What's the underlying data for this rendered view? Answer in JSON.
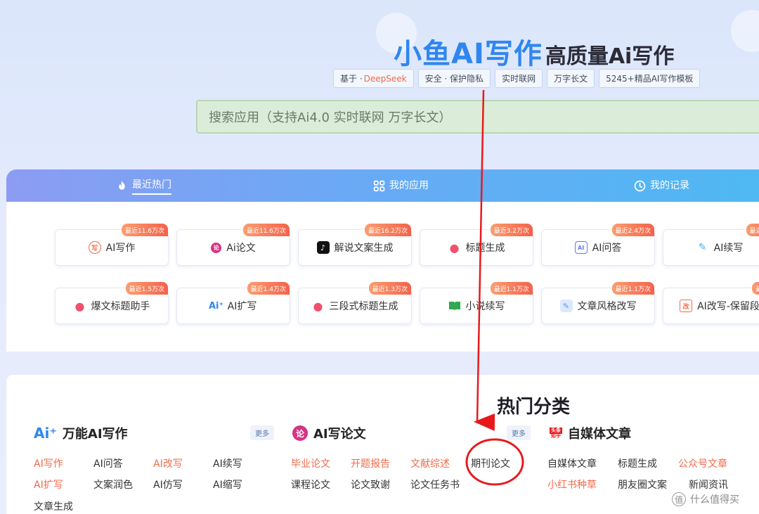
{
  "header": {
    "brand_main": "小鱼AI写作",
    "brand_sub": "高质量Ai写作",
    "tags": [
      {
        "text": "基于 · ",
        "highlight": "DeepSeek"
      },
      {
        "text": "安全 · 保护隐私",
        "highlight": ""
      },
      {
        "text": "实时联网",
        "highlight": ""
      },
      {
        "text": "万字长文",
        "highlight": ""
      },
      {
        "text": "5245+精品AI写作模板",
        "highlight": ""
      }
    ]
  },
  "search": {
    "placeholder": "搜索应用（支持Ai4.0 实时联网 万字长文）"
  },
  "tabs": [
    {
      "label": "最近热门",
      "icon": "fire-icon",
      "active": true
    },
    {
      "label": "我的应用",
      "icon": "grid-icon",
      "active": false
    },
    {
      "label": "我的记录",
      "icon": "clock-icon",
      "active": false
    }
  ],
  "apps_row1": [
    {
      "label": "AI写作",
      "badge": "最近11.6万次",
      "icon": "write-icon",
      "color": "#f26a4a"
    },
    {
      "label": "Ai论文",
      "badge": "最近11.6万次",
      "icon": "paper-icon",
      "color": "#d63384"
    },
    {
      "label": "解说文案生成",
      "badge": "最近16.2万次",
      "icon": "tiktok-icon",
      "color": "#111111"
    },
    {
      "label": "标题生成",
      "badge": "最近3.2万次",
      "icon": "tag-icon",
      "color": "#f0506e"
    },
    {
      "label": "AI问答",
      "badge": "最近2.4万次",
      "icon": "chat-icon",
      "color": "#5b7cf0"
    },
    {
      "label": "AI续写",
      "badge": "最近2.2",
      "icon": "pen-icon",
      "color": "#4db0e8"
    }
  ],
  "apps_row2": [
    {
      "label": "爆文标题助手",
      "badge": "最近1.5万次",
      "icon": "tag-icon",
      "color": "#f0506e"
    },
    {
      "label": "AI扩写",
      "badge": "最近1.4万次",
      "icon": "ai-expand-icon",
      "color": "#2f86f0"
    },
    {
      "label": "三段式标题生成",
      "badge": "最近1.3万次",
      "icon": "tag-icon",
      "color": "#f0506e"
    },
    {
      "label": "小说续写",
      "badge": "最近1.1万次",
      "icon": "book-icon",
      "color": "#2fa84f"
    },
    {
      "label": "文章风格改写",
      "badge": "最近1.1万次",
      "icon": "edit-icon",
      "color": "#5b9cf0"
    },
    {
      "label": "AI改写-保留段",
      "badge": "最近1",
      "icon": "rewrite-icon",
      "color": "#f26a4a"
    }
  ],
  "hot": {
    "title": "热门分类",
    "more_label": "更多",
    "categories": [
      {
        "name": "万能AI写作",
        "links": [
          {
            "text": "AI写作",
            "hot": true
          },
          {
            "text": "AI问答",
            "hot": false
          },
          {
            "text": "AI改写",
            "hot": true
          },
          {
            "text": "AI续写",
            "hot": false
          },
          {
            "text": "AI扩写",
            "hot": true
          },
          {
            "text": "文案润色",
            "hot": false
          },
          {
            "text": "AI仿写",
            "hot": false
          },
          {
            "text": "AI缩写",
            "hot": false
          },
          {
            "text": "文章生成",
            "hot": false
          }
        ]
      },
      {
        "name": "AI写论文",
        "icon_text": "论",
        "links": [
          {
            "text": "毕业论文",
            "hot": true
          },
          {
            "text": "开题报告",
            "hot": true
          },
          {
            "text": "文献综述",
            "hot": true
          },
          {
            "text": "期刊论文",
            "hot": false
          },
          {
            "text": "课程论文",
            "hot": false
          },
          {
            "text": "论文致谢",
            "hot": false
          },
          {
            "text": "论文任务书",
            "hot": false
          }
        ]
      },
      {
        "name": "自媒体文章",
        "icon_text_top": "头条",
        "icon_text_bottom": "知乎",
        "links": [
          {
            "text": "自媒体文章",
            "hot": false
          },
          {
            "text": "标题生成",
            "hot": false
          },
          {
            "text": "公众号文章",
            "hot": true
          },
          {
            "text": "小红书种草",
            "hot": true
          },
          {
            "text": "朋友圈文案",
            "hot": false
          },
          {
            "text": "新闻资讯",
            "hot": false
          }
        ]
      }
    ]
  },
  "watermark": {
    "icon": "值",
    "text": "什么值得买"
  },
  "colors": {
    "brand": "#2f86f0",
    "hot": "#f26a4a",
    "annotation": "#e8191b"
  }
}
